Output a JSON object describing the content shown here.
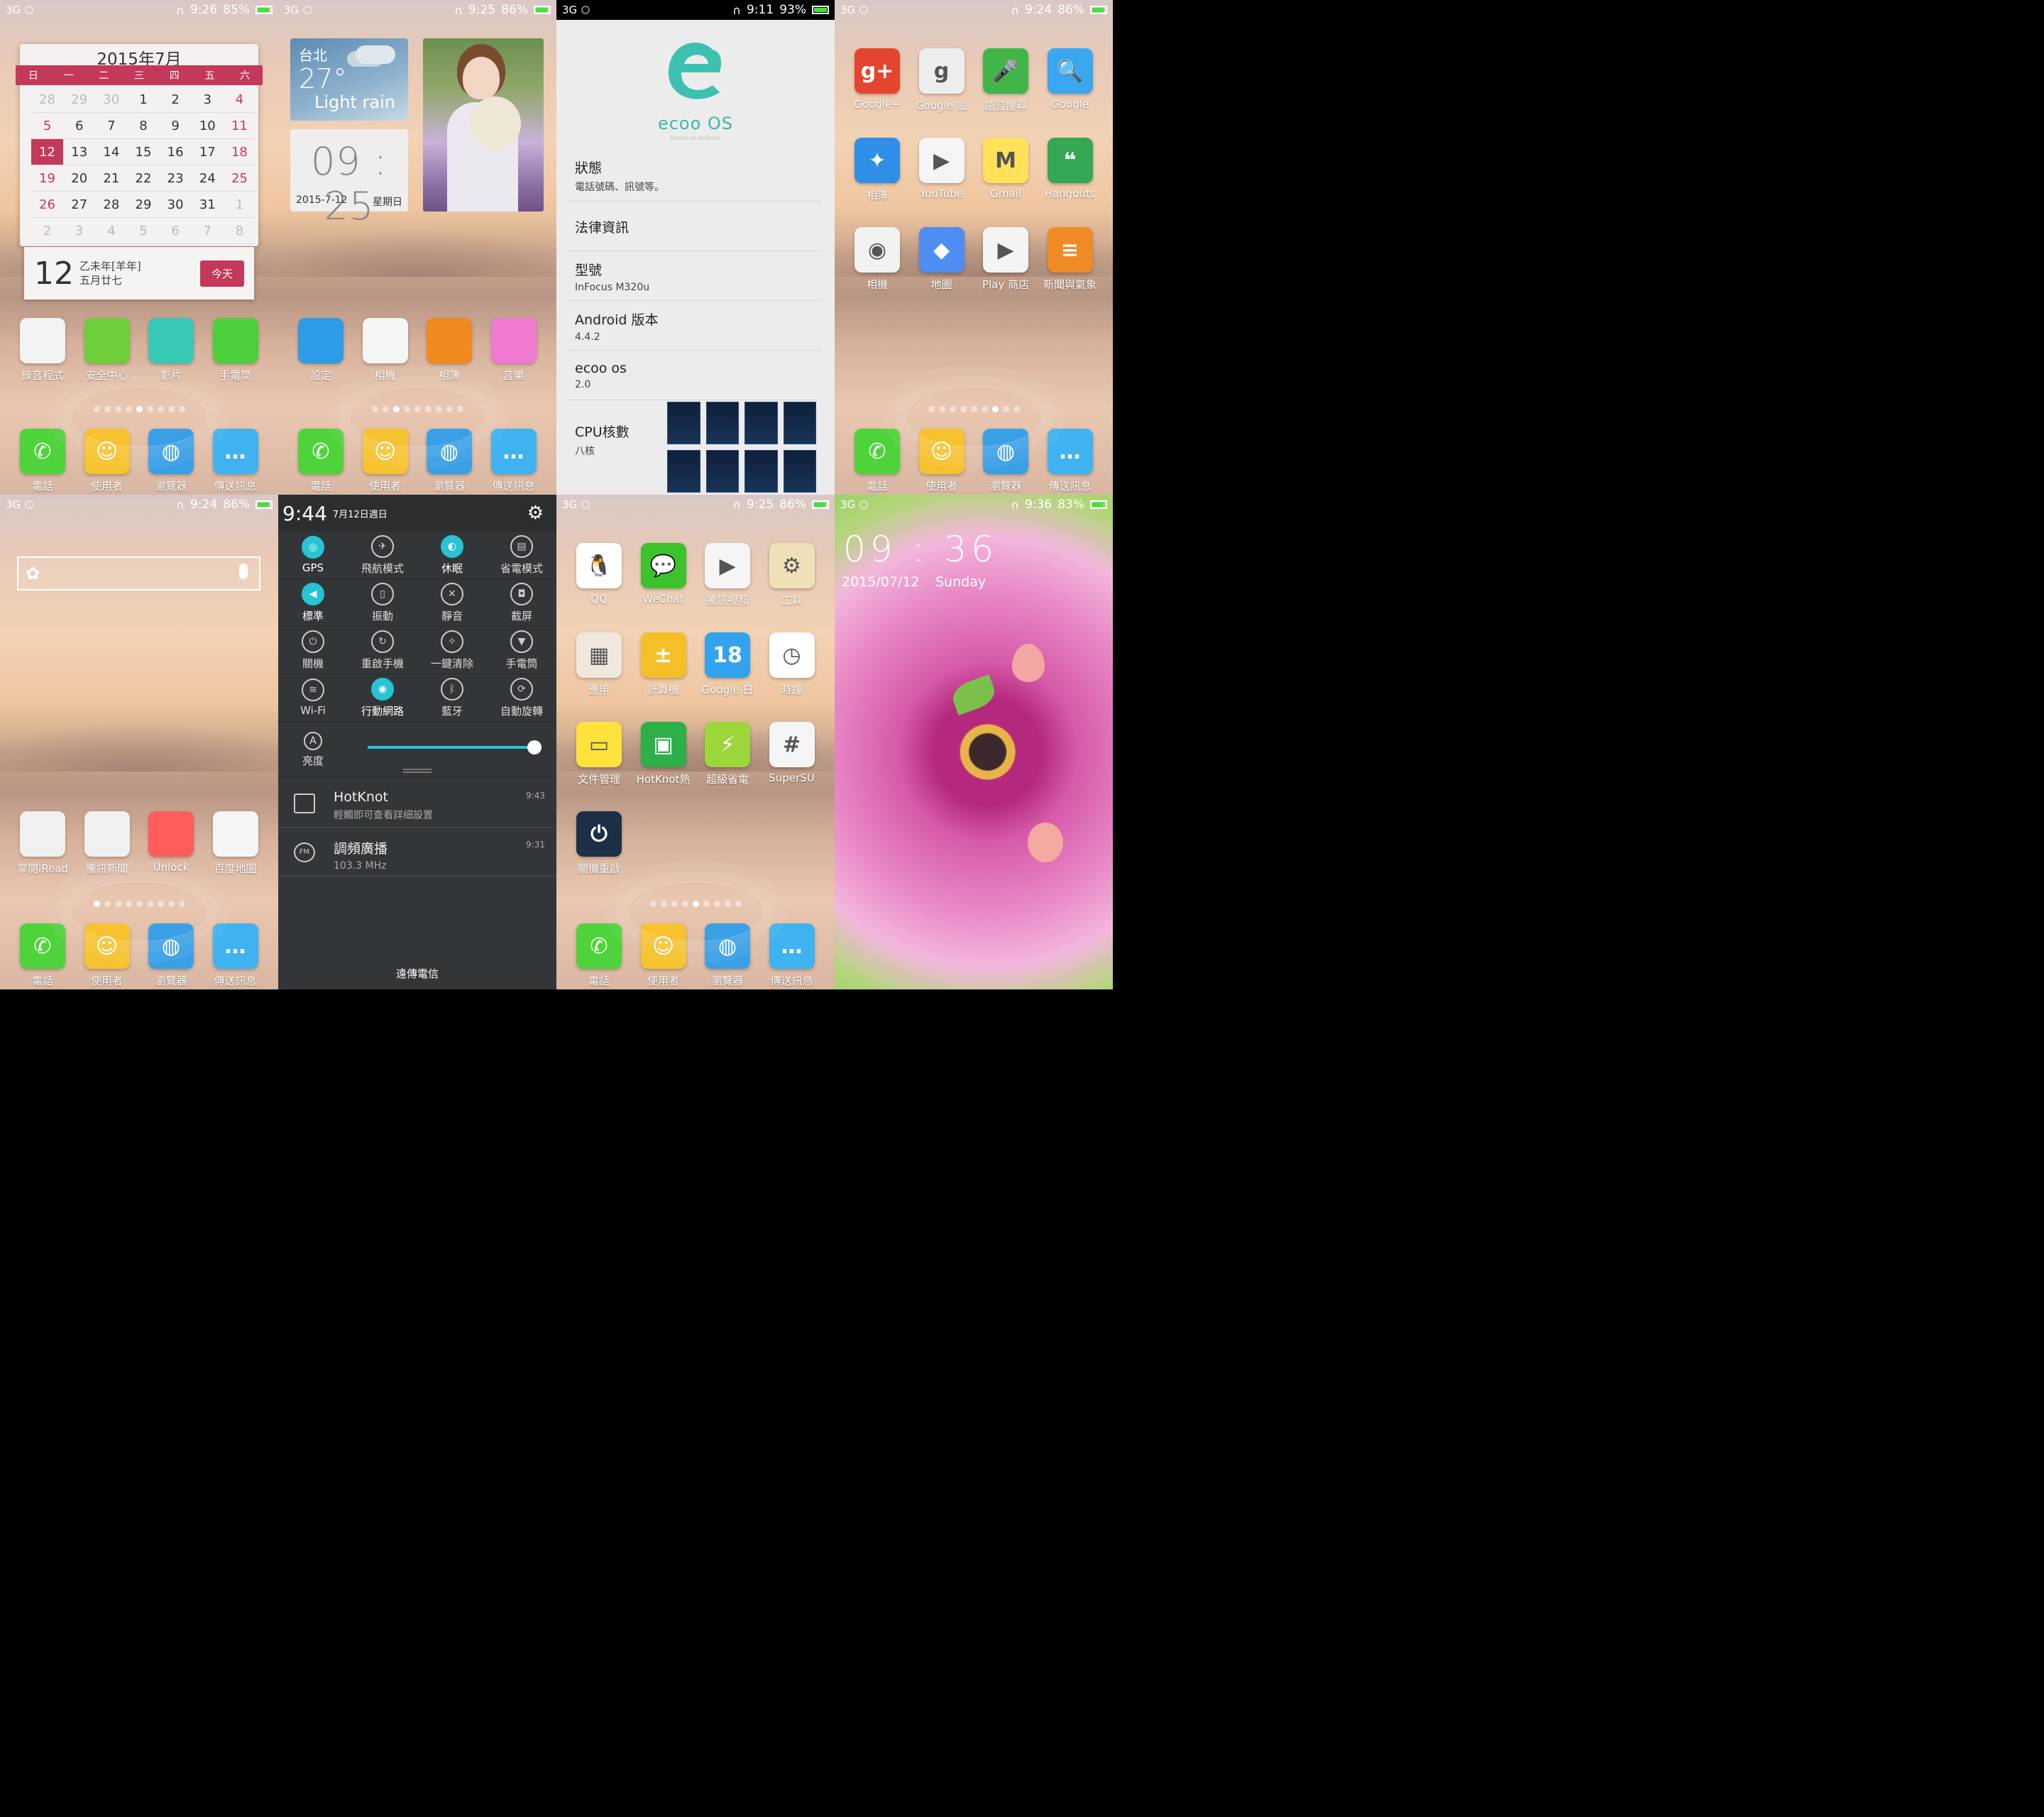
{
  "status_bars": {
    "p1": {
      "net": "3G",
      "time": "9:26",
      "battery": "85%"
    },
    "p2": {
      "net": "3G",
      "time": "9:25",
      "battery": "86%"
    },
    "p3": {
      "net": "3G",
      "time": "9:11",
      "battery": "93%"
    },
    "p4": {
      "net": "3G",
      "time": "9:24",
      "battery": "86%"
    },
    "p5": {
      "net": "3G",
      "time": "9:24",
      "battery": "86%"
    },
    "p7": {
      "net": "3G",
      "time": "9:25",
      "battery": "86%"
    },
    "p8": {
      "net": "3G",
      "time": "9:36",
      "battery": "83%"
    }
  },
  "dock": [
    "電話",
    "使用者",
    "瀏覽器",
    "傳送訊息"
  ],
  "calendar": {
    "title": "2015年7月",
    "weekdays": [
      "日",
      "一",
      "二",
      "三",
      "四",
      "五",
      "六"
    ],
    "days": [
      "28",
      "29",
      "30",
      "1",
      "2",
      "3",
      "4",
      "5",
      "6",
      "7",
      "8",
      "9",
      "10",
      "11",
      "12",
      "13",
      "14",
      "15",
      "16",
      "17",
      "18",
      "19",
      "20",
      "21",
      "22",
      "23",
      "24",
      "25",
      "26",
      "27",
      "28",
      "29",
      "30",
      "31",
      "1",
      "2",
      "3",
      "4",
      "5",
      "6",
      "7",
      "8"
    ],
    "big_day": "12",
    "lunar_line1": "乙未年[羊年]",
    "lunar_line2": "五月廿七",
    "today_button": "今天"
  },
  "p1_apps": [
    "錄音程式",
    "安全中心",
    "影片",
    "手電筒"
  ],
  "p1_colors": [
    "#f3f3f3",
    "#6fcf3a",
    "#37c9b5",
    "#4bd03c"
  ],
  "weather": {
    "city": "台北",
    "temp": "27°",
    "condition": "Light rain"
  },
  "clock_widget": {
    "time": "09 : 25",
    "date": "2015-7-12",
    "weekday": "星期日"
  },
  "p2_apps": [
    "設定",
    "相機",
    "相簿",
    "音樂"
  ],
  "p2_colors": [
    "#2e9be8",
    "#f5f5f5",
    "#f08a1f",
    "#f07ad0"
  ],
  "about": {
    "brand": "ecoo OS",
    "brand_sub": "based on Android",
    "rows": [
      {
        "title": "狀態",
        "sub": "電話號碼、訊號等。"
      },
      {
        "title": "法律資訊",
        "sub": ""
      },
      {
        "title": "型號",
        "sub": "InFocus M320u"
      },
      {
        "title": "Android 版本",
        "sub": "4.4.2"
      },
      {
        "title": "ecoo os",
        "sub": "2.0"
      },
      {
        "title": "CPU核數",
        "sub": "八核"
      }
    ]
  },
  "p4_apps": [
    "Google+",
    "Google 設",
    "語音搜尋",
    "Google",
    "相簿",
    "YouTube",
    "Gmail",
    "Hangouts",
    "相機",
    "地圖",
    "Play 商店",
    "新聞與氣象"
  ],
  "p4_glyphs": [
    "g+",
    "g",
    "🎤",
    "🔍",
    "✦",
    "▶",
    "M",
    "❝",
    "◉",
    "◆",
    "▶",
    "≡"
  ],
  "p4_colors": [
    "#e4452f",
    "#eeeeee",
    "#41b54a",
    "#3aa7f0",
    "#2f8fe8",
    "#f5f5f5",
    "#ffe25a",
    "#34a853",
    "#f2f2f2",
    "#4e8df1",
    "#f4f4f4",
    "#f08a25"
  ],
  "p5_apps": [
    "掌閱iRead",
    "騰訊新聞",
    "Unlock",
    "百度地圖"
  ],
  "p5_colors": [
    "#f0f0f0",
    "#f0f0f0",
    "#ff5c5c",
    "#f5f5f5"
  ],
  "shade": {
    "time": "9:44",
    "date": "7月12日週日",
    "toggles": [
      [
        "GPS",
        "飛航模式",
        "休眠",
        "省電模式"
      ],
      [
        "標準",
        "振動",
        "靜音",
        "截屏"
      ],
      [
        "關機",
        "重啟手機",
        "一鍵清除",
        "手電筒"
      ],
      [
        "Wi-Fi",
        "行動網路",
        "藍牙",
        "自動旋轉"
      ]
    ],
    "brightness_label": "亮度",
    "brightness_level": 0.98,
    "notifications": [
      {
        "title": "HotKnot",
        "sub": "輕觸即可查看詳細設置",
        "time": "9:43"
      },
      {
        "title": "調頻廣播",
        "sub": "103.3 MHz",
        "time": "9:31"
      }
    ],
    "carrier": "遠傳電信"
  },
  "p7_apps": [
    "QQ",
    "WeChat",
    "騰訊視頻",
    "工具",
    "應用",
    "計算機",
    "Google 日",
    "時鐘",
    "文件管理",
    "HotKnot熱",
    "超級省電",
    "SuperSU",
    "關機重啟"
  ],
  "p7_glyphs": [
    "🐧",
    "💬",
    "▶",
    "⚙",
    "▦",
    "±",
    "18",
    "◷",
    "▭",
    "▣",
    "⚡",
    "#",
    "⏻"
  ],
  "p7_colors": [
    "#ffffff",
    "#3cc22c",
    "#f5f5f5",
    "#f0e0b8",
    "#f0e8dc",
    "#f5c027",
    "#31a3ef",
    "#ffffff",
    "#ffe23c",
    "#2db04a",
    "#9bd63a",
    "#f5f5f5",
    "#1d2f46"
  ],
  "lock": {
    "time": "09 : 36",
    "date": "2015/07/12",
    "weekday": "Sunday"
  }
}
